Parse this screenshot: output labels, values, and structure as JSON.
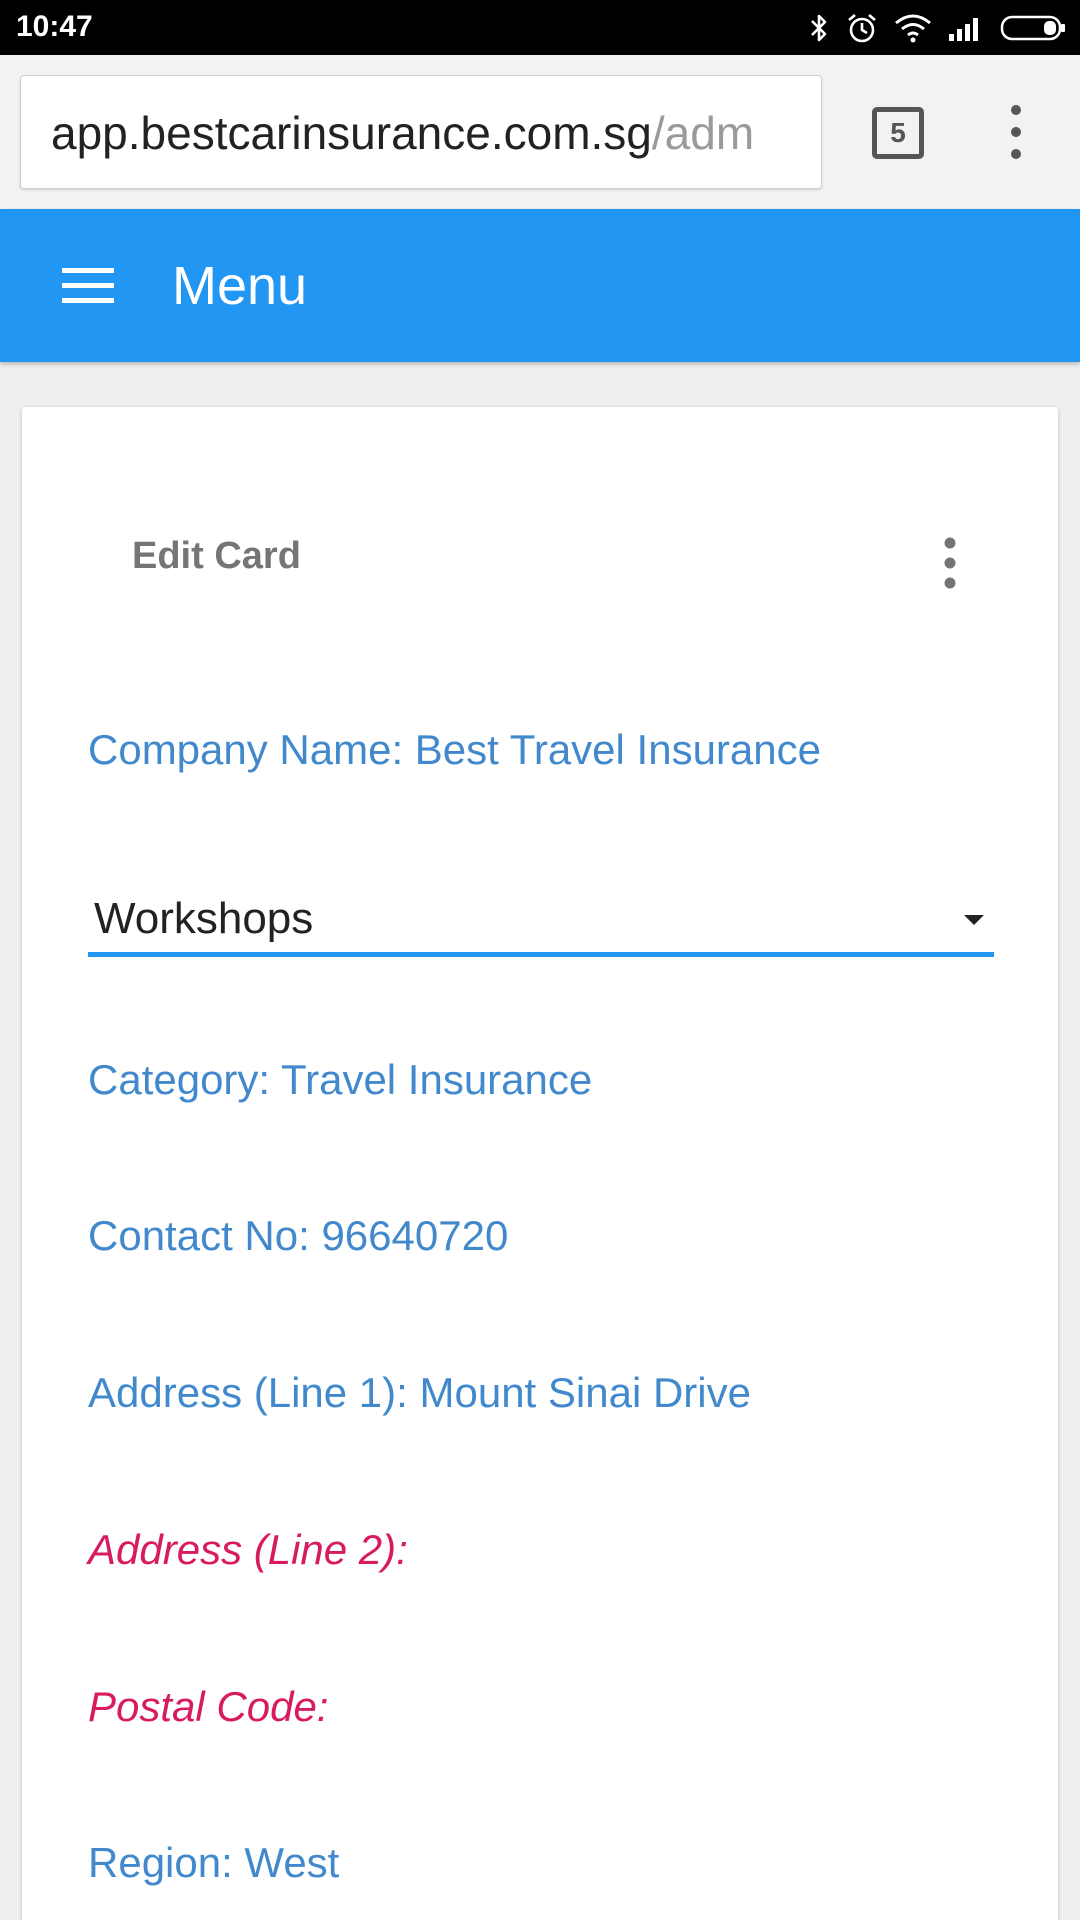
{
  "status_bar": {
    "time": "10:47",
    "icons": [
      "bluetooth-icon",
      "alarm-icon",
      "wifi-icon",
      "signal-icon",
      "battery-icon"
    ]
  },
  "browser": {
    "url_host": "app.bestcarinsurance.com.sg",
    "url_path": "/adm",
    "tab_count": "5"
  },
  "app_bar": {
    "title": "Menu",
    "color": "#2196f3"
  },
  "card": {
    "header": "Edit Card",
    "company_name": "Company Name: Best Travel Insurance",
    "select_value": "Workshops",
    "category": "Category: Travel Insurance",
    "contact": "Contact No: 96640720",
    "address1": "Address (Line 1): Mount Sinai Drive",
    "address2": "Address (Line 2):",
    "postal": "Postal Code:",
    "region": "Region: West"
  },
  "colors": {
    "field_text": "#4189cc",
    "missing_text": "#d81b60",
    "accent": "#2196f3"
  }
}
